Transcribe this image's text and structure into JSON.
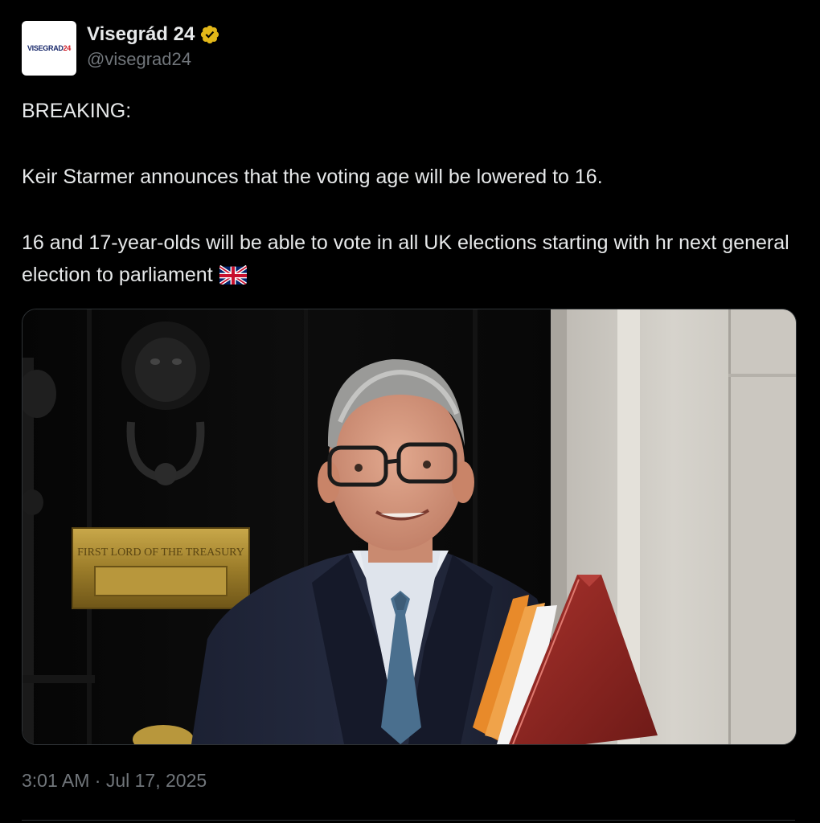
{
  "author": {
    "display_name": "Visegrád 24",
    "handle": "@visegrad24",
    "verified_badge": "gold-verified-badge-icon",
    "avatar_text_main": "VISEGRAD",
    "avatar_text_accent": "24"
  },
  "post": {
    "line1": "BREAKING:",
    "line2": "Keir Starmer announces that the voting age will be lowered to 16.",
    "line3": "16 and 17-year-olds will be able to vote in all UK elections starting with hr next general election to parliament",
    "emoji": "uk-flag-icon",
    "media": {
      "plaque_text": "FIRST LORD OF THE TREASURY"
    }
  },
  "meta": {
    "timestamp": "3:01 AM · Jul 17, 2025"
  },
  "colors": {
    "background": "#000000",
    "text": "#e7e9ea",
    "muted": "#71767b",
    "verified_gold": "#e2b719",
    "border": "#2f3336"
  }
}
